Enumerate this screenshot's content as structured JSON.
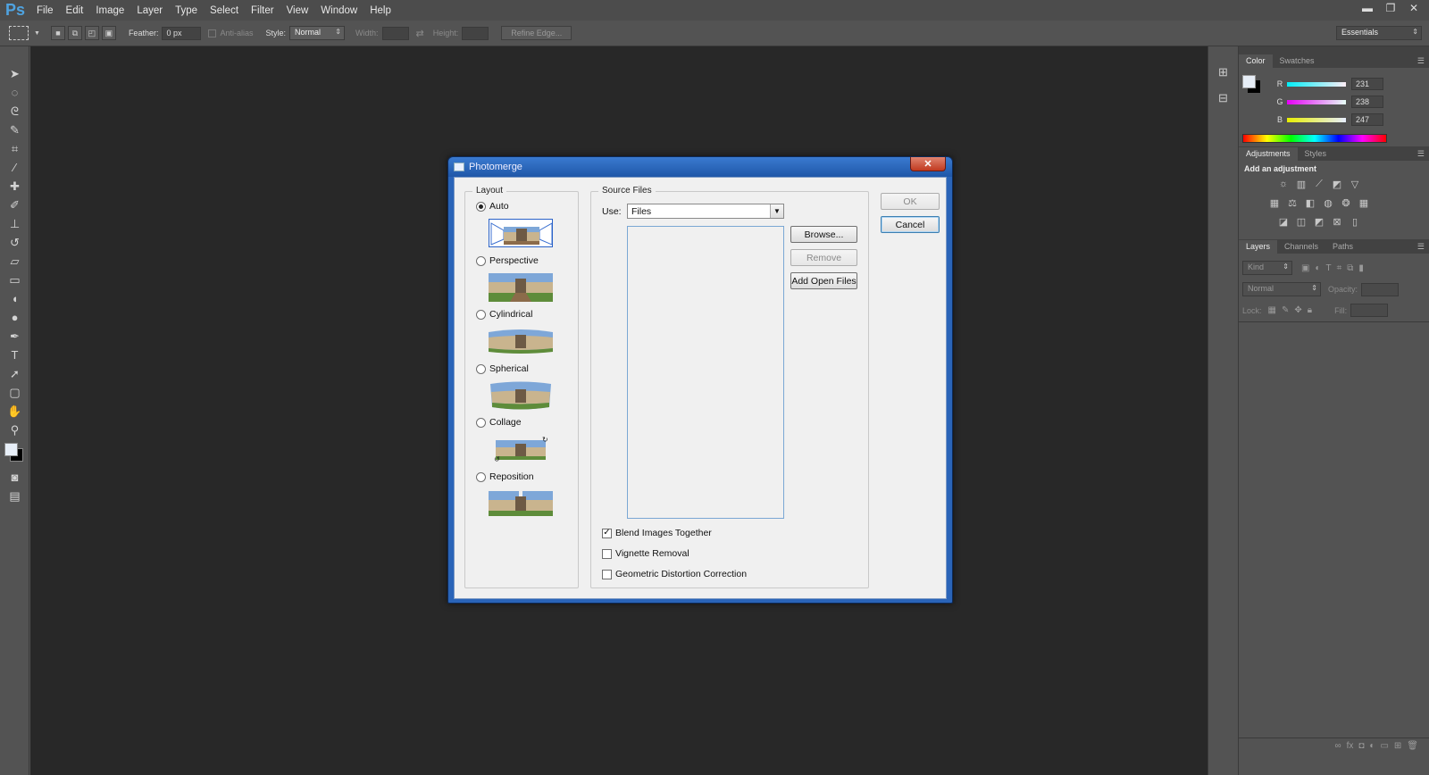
{
  "app": {
    "logo": "Ps"
  },
  "menu": [
    "File",
    "Edit",
    "Image",
    "Layer",
    "Type",
    "Select",
    "Filter",
    "View",
    "Window",
    "Help"
  ],
  "options_bar": {
    "feather_label": "Feather:",
    "feather_value": "0 px",
    "antialias_label": "Anti-alias",
    "style_label": "Style:",
    "style_value": "Normal",
    "width_label": "Width:",
    "height_label": "Height:",
    "refine_edge": "Refine Edge...",
    "workspace": "Essentials"
  },
  "color_panel": {
    "tabs": [
      "Color",
      "Swatches"
    ],
    "r_label": "R",
    "r_value": "231",
    "g_label": "G",
    "g_value": "238",
    "b_label": "B",
    "b_value": "247"
  },
  "adjustments_panel": {
    "tabs": [
      "Adjustments",
      "Styles"
    ],
    "heading": "Add an adjustment"
  },
  "layers_panel": {
    "tabs": [
      "Layers",
      "Channels",
      "Paths"
    ],
    "kind": "Kind",
    "blend_mode": "Normal",
    "opacity_label": "Opacity:",
    "lock_label": "Lock:",
    "fill_label": "Fill:"
  },
  "dialog": {
    "title": "Photomerge",
    "close_glyph": "✕",
    "layout_title": "Layout",
    "layouts": [
      {
        "label": "Auto",
        "selected": true
      },
      {
        "label": "Perspective",
        "selected": false
      },
      {
        "label": "Cylindrical",
        "selected": false
      },
      {
        "label": "Spherical",
        "selected": false
      },
      {
        "label": "Collage",
        "selected": false
      },
      {
        "label": "Reposition",
        "selected": false
      }
    ],
    "source_title": "Source Files",
    "use_label": "Use:",
    "use_value": "Files",
    "browse": "Browse...",
    "remove": "Remove",
    "add_open_files": "Add Open Files",
    "ok": "OK",
    "cancel": "Cancel",
    "options": [
      {
        "label": "Blend Images Together",
        "checked": true
      },
      {
        "label": "Vignette Removal",
        "checked": false
      },
      {
        "label": "Geometric Distortion Correction",
        "checked": false
      }
    ]
  }
}
